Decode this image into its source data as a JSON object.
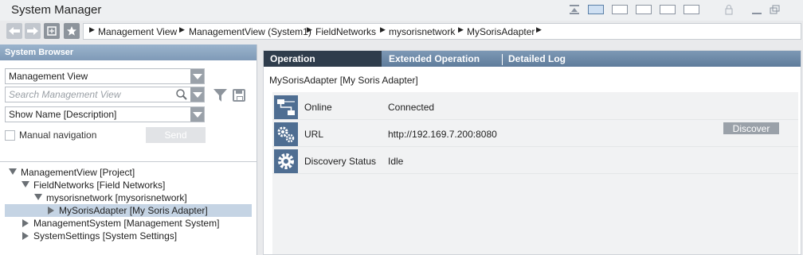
{
  "app": {
    "title": "System Manager"
  },
  "colors": {
    "header_blue": "#7f9ab7",
    "icon_blue": "#4f6e92",
    "active_tab": "#2f3d4c",
    "selection": "#c5d4e4"
  },
  "nav": {
    "buttons": [
      {
        "icon": "back-arrow-icon"
      },
      {
        "icon": "forward-arrow-icon"
      },
      {
        "icon": "home-icon"
      },
      {
        "icon": "favorite-star-icon"
      }
    ],
    "breadcrumb": [
      "Management View",
      "ManagementView (System1)",
      "FieldNetworks",
      "mysorisnetwork",
      "MySorisAdapter"
    ]
  },
  "browser": {
    "header": "System Browser",
    "view_select": "Management View",
    "search_placeholder": "Search Management View",
    "display_select": "Show Name [Description]",
    "manual_nav_label": "Manual navigation",
    "send_label": "Send",
    "tree": [
      {
        "label": "ManagementView [Project]",
        "expanded": true,
        "selected": false
      },
      {
        "label": "FieldNetworks [Field Networks]",
        "expanded": true,
        "selected": false
      },
      {
        "label": "mysorisnetwork [mysorisnetwork]",
        "expanded": true,
        "selected": false
      },
      {
        "label": "MySorisAdapter [My Soris Adapter]",
        "expanded": false,
        "selected": true
      },
      {
        "label": "ManagementSystem [Management System]",
        "expanded": false,
        "selected": false
      },
      {
        "label": "SystemSettings [System Settings]",
        "expanded": false,
        "selected": false
      }
    ]
  },
  "main": {
    "tabs": [
      "Operation",
      "Extended Operation",
      "Detailed Log"
    ],
    "active_tab": "Operation",
    "object_title": "MySorisAdapter [My Soris Adapter]",
    "properties": [
      {
        "label": "Online",
        "value": "Connected",
        "icon": "network-icon"
      },
      {
        "label": "URL",
        "value": "http://192.169.7.200:8080",
        "icon": "gears-icon"
      },
      {
        "label": "Discovery Status",
        "value": "Idle",
        "icon": "gear-icon"
      }
    ],
    "discover_label": "Discover"
  }
}
